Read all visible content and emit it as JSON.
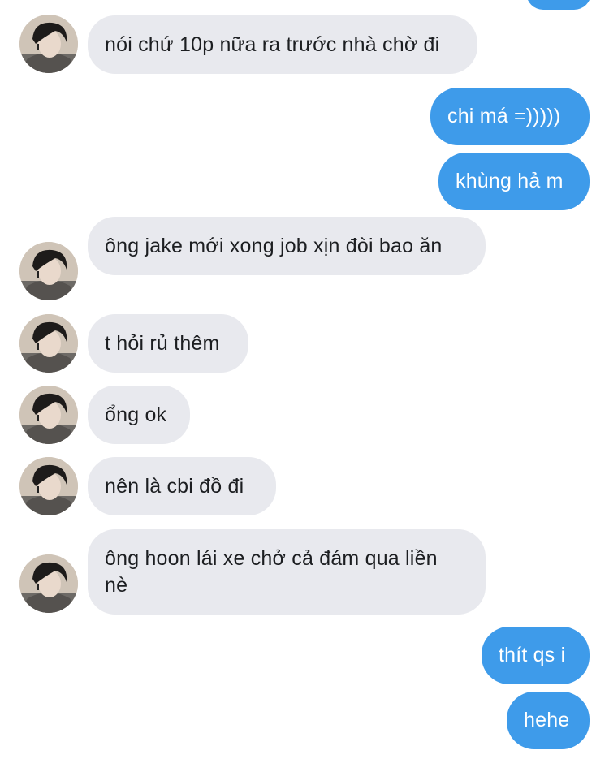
{
  "conversation": {
    "messages": [
      {
        "side": "out",
        "text": ""
      },
      {
        "side": "in",
        "text": "nói chứ 10p nữa ra trước nhà chờ đi"
      },
      {
        "side": "out",
        "text": "chi má =)))))"
      },
      {
        "side": "out",
        "text": "khùng hả m"
      },
      {
        "side": "in",
        "text": "ông jake mới xong job xịn đòi bao ăn"
      },
      {
        "side": "in",
        "text": "t hỏi rủ thêm"
      },
      {
        "side": "in",
        "text": "ổng ok"
      },
      {
        "side": "in",
        "text": "nên là cbi đồ đi"
      },
      {
        "side": "in",
        "text": "ông hoon lái xe chở cả đám qua liền nè"
      },
      {
        "side": "out",
        "text": "thít qs i"
      },
      {
        "side": "out",
        "text": "hehe"
      }
    ]
  },
  "colors": {
    "incoming_bubble": "#e8e9ee",
    "outgoing_bubble": "#3e9bea",
    "incoming_text": "#1c1e21",
    "outgoing_text": "#ffffff"
  }
}
